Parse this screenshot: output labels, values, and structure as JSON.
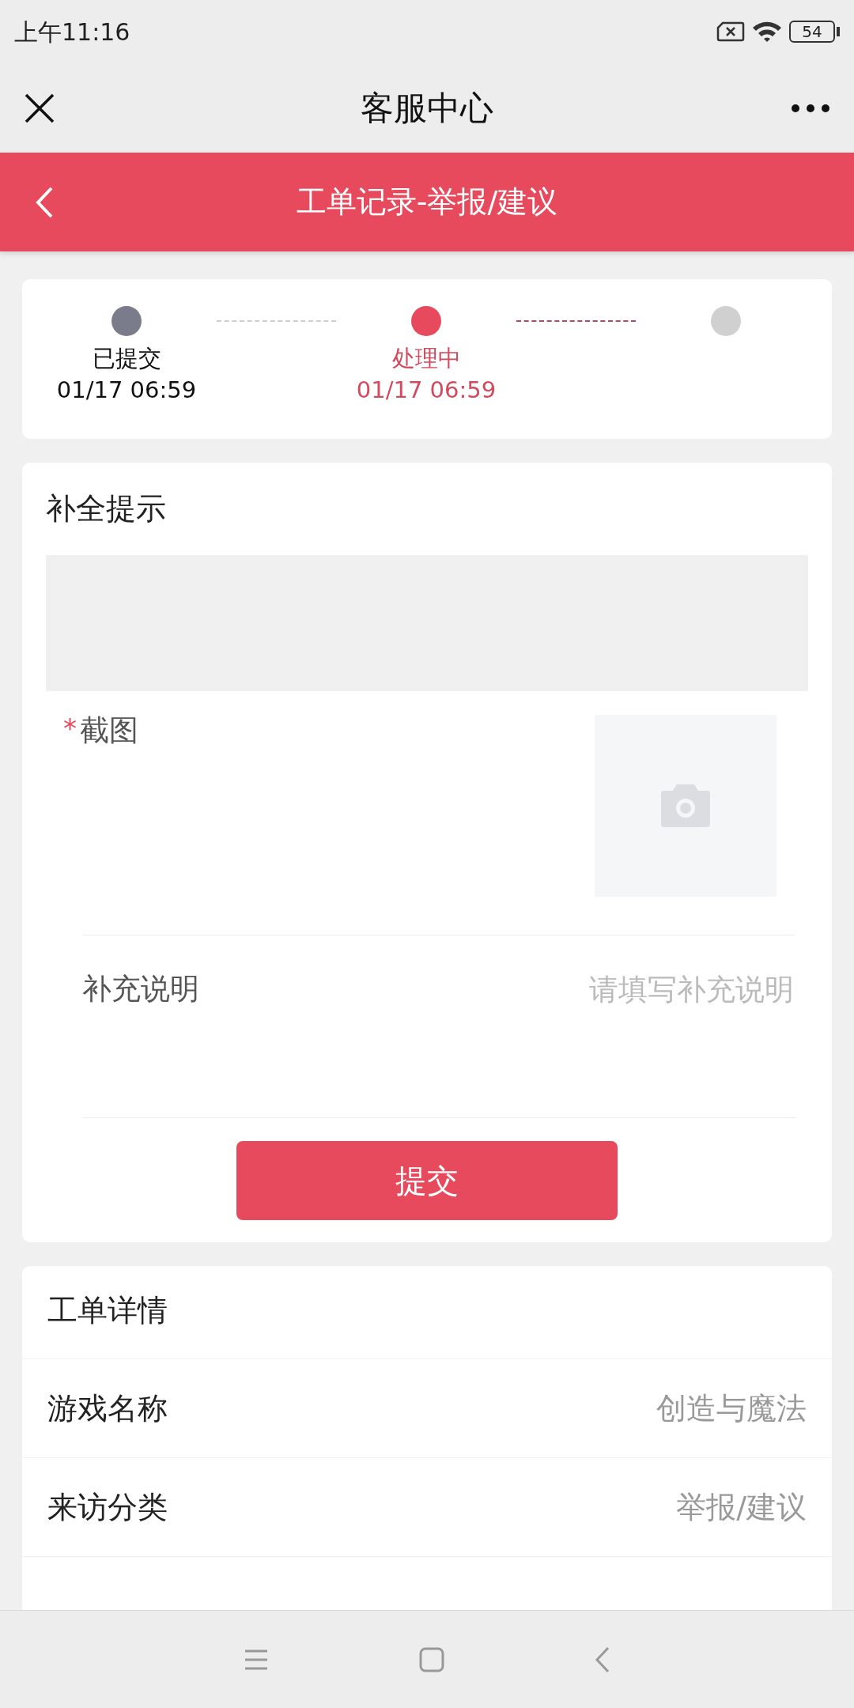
{
  "status_bar": {
    "time": "上午11:16",
    "battery": "54"
  },
  "app_bar": {
    "title": "客服中心"
  },
  "header": {
    "title": "工单记录-举报/建议"
  },
  "progress": {
    "steps": [
      {
        "label": "已提交",
        "time": "01/17 06:59",
        "completed": true,
        "current": false
      },
      {
        "label": "处理中",
        "time": "01/17 06:59",
        "completed": false,
        "current": true
      },
      {
        "completed": false,
        "current": false
      }
    ]
  },
  "supplement": {
    "title": "补全提示",
    "screenshot": {
      "required_mark": "*",
      "label": "截图"
    },
    "note": {
      "label": "补充说明",
      "placeholder": "请填写补充说明"
    },
    "submit_button": "提交"
  },
  "details": {
    "title": "工单详情",
    "rows": [
      {
        "label": "游戏名称",
        "value": "创造与魔法"
      },
      {
        "label": "来访分类",
        "value": "举报/建议"
      }
    ]
  }
}
